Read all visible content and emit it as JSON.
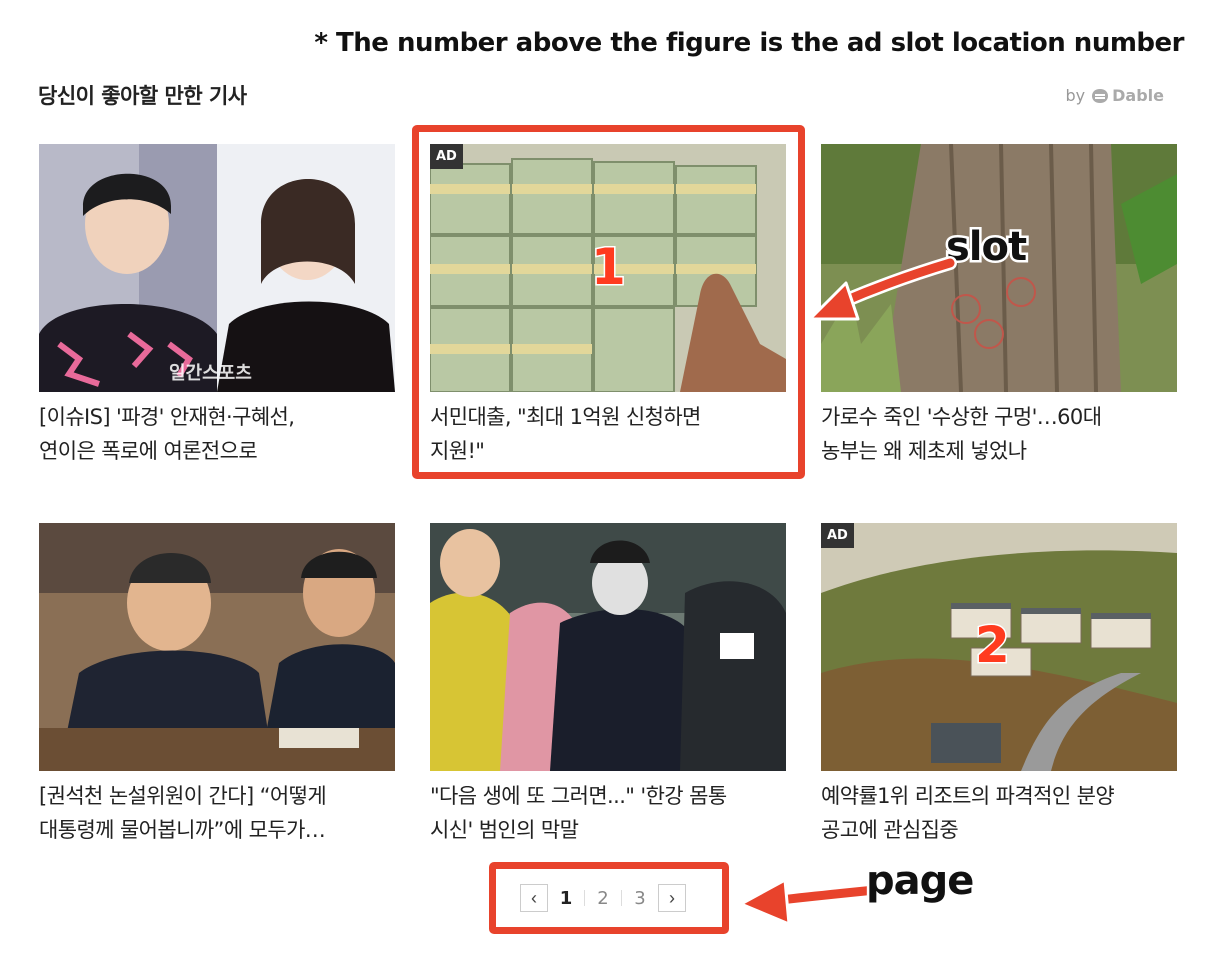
{
  "note": "* The number above the figure is the ad slot location number",
  "widget": {
    "title": "당신이 좋아할 만한 기사",
    "by": "by",
    "brand": "Dable"
  },
  "ad_badge": "AD",
  "cards": [
    {
      "caption_line1": "[이슈IS] '파경' 안재현·구혜선,",
      "caption_line2": "연이은 폭로에 여론전으로",
      "watermark": "일간스포츠"
    },
    {
      "caption_line1": "서민대출, \"최대 1억원 신청하면",
      "caption_line2": "지원!\""
    },
    {
      "caption_line1": "가로수 죽인 '수상한 구멍'…60대",
      "caption_line2": "농부는 왜 제초제 넣었나"
    },
    {
      "caption_line1": "[권석천 논설위원이 간다] “어떻게",
      "caption_line2": "대통령께 물어봅니까”에 모두가…"
    },
    {
      "caption_line1": "\"다음 생에 또 그러면...\" '한강 몸통",
      "caption_line2": "시신' 범인의 막말"
    },
    {
      "caption_line1": "예약률1위 리조트의 파격적인 분양",
      "caption_line2": "공고에 관심집중"
    }
  ],
  "annotations": {
    "slot_label": "slot",
    "page_label": "page",
    "slot1": "1",
    "slot2": "2"
  },
  "pagination": {
    "prev": "‹",
    "next": "›",
    "pages": [
      "1",
      "2",
      "3"
    ],
    "current": "1"
  },
  "colors": {
    "annotation_red": "#e8432c",
    "ad_badge_bg": "#333333",
    "text": "#222222"
  }
}
